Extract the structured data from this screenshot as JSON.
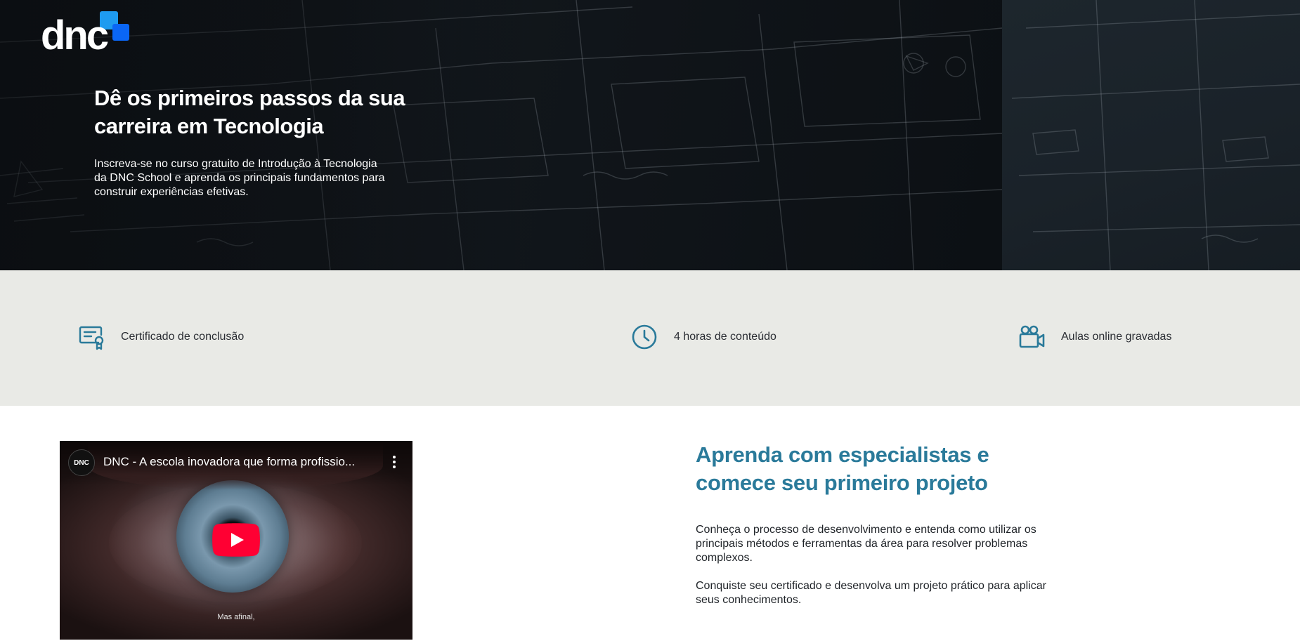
{
  "brand": {
    "logo_text": "dnc"
  },
  "hero": {
    "title": "Dê os primeiros passos da sua carreira em Tecnologia",
    "subtitle": "Inscreva-se no curso gratuito de Introdução à Tecnologia da DNC School e aprenda os principais fundamentos para construir experiências efetivas."
  },
  "features": [
    {
      "icon": "certificate-icon",
      "label": "Certificado de conclusão"
    },
    {
      "icon": "clock-icon",
      "label": "4 horas de conteúdo"
    },
    {
      "icon": "video-camera-icon",
      "label": "Aulas online gravadas"
    }
  ],
  "video": {
    "channel_avatar": "DNC",
    "title": "DNC - A escola inovadora que forma profissio...",
    "caption": "Mas afinal,"
  },
  "section": {
    "title": "Aprenda com especialistas e comece seu primeiro projeto",
    "paragraphs": [
      "Conheça o processo de desenvolvimento e entenda como utilizar os principais métodos e ferramentas da área para resolver problemas complexos.",
      "Conquiste seu certificado e desenvolva um projeto prático para aplicar seus conhecimentos."
    ]
  },
  "colors": {
    "accent": "#2a7a9a",
    "features_bg": "#e9eae6",
    "youtube_red": "#ff0033",
    "logo_blue": "#1e9bf0"
  }
}
